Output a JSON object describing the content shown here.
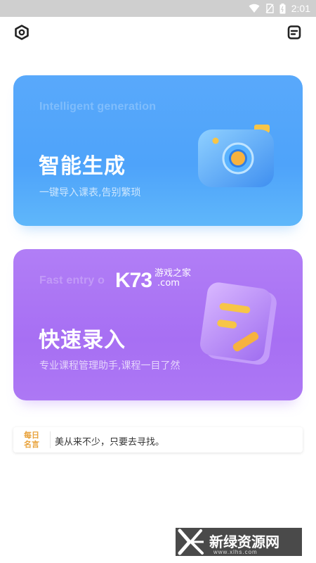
{
  "status_bar": {
    "time": "2:01"
  },
  "header": {
    "left_icon": "settings-hexagon-icon",
    "right_icon": "document-list-icon"
  },
  "cards": [
    {
      "subtitle_en": "Intelligent generation",
      "title": "智能生成",
      "description": "一键导入课表,告别繁琐",
      "icon": "camera-icon",
      "color": "#4ea3fa"
    },
    {
      "subtitle_en": "Fast entry o",
      "title": "快速录入",
      "description": "专业课程管理助手,课程一目了然",
      "icon": "note-pencil-icon",
      "color": "#a76ff3"
    }
  ],
  "quote": {
    "badge_line1": "每日",
    "badge_line2": "名言",
    "text": "美从来不少，只要去寻找。"
  },
  "watermarks": {
    "k73_logo": "K73",
    "k73_cn": "游戏之家",
    "k73_com": ".com",
    "footer_text": "新绿资源网",
    "footer_url": "www.xlhs.com"
  }
}
